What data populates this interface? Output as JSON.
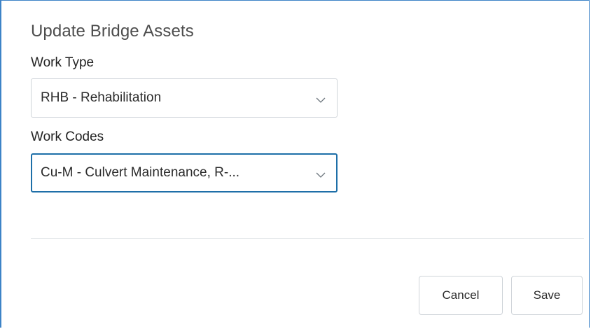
{
  "dialog": {
    "title": "Update Bridge Assets"
  },
  "work_type": {
    "label": "Work Type",
    "selected": "RHB - Rehabilitation"
  },
  "work_codes": {
    "label": "Work Codes",
    "selected": "Cu-M - Culvert Maintenance, R-..."
  },
  "buttons": {
    "cancel_label": "Cancel",
    "save_label": "Save"
  },
  "icons": {
    "dropdown": "chevron-down-icon"
  },
  "colors": {
    "accent_border": "#3d83c7",
    "focus_border": "#1e6fa8"
  }
}
